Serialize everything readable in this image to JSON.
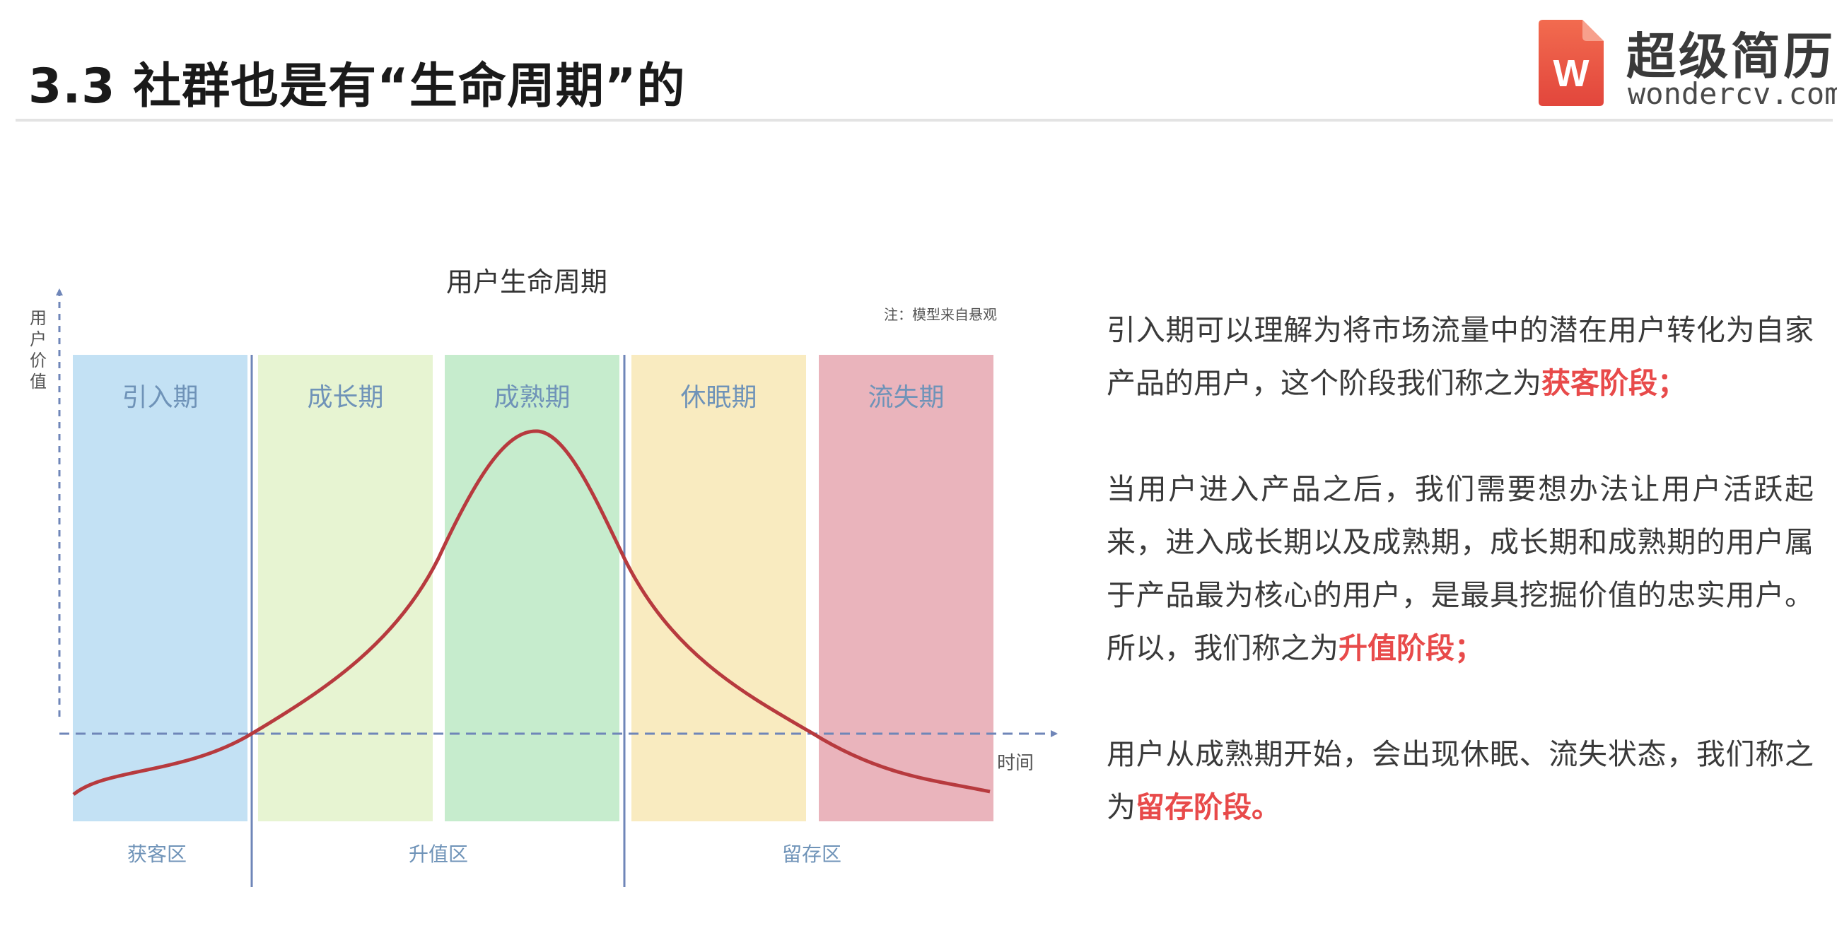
{
  "header": {
    "title": "3.3 社群也是有“生命周期”的"
  },
  "logo": {
    "mark": "W",
    "cn": "超级简历",
    "en": "wondercv.com"
  },
  "diagram": {
    "title": "用户生命周期",
    "note": "注：模型来自悬观",
    "y_axis_label": [
      "用",
      "户",
      "价",
      "值"
    ],
    "x_axis_label": "时间",
    "stages": [
      {
        "label": "引入期",
        "color": "#c3e1f4"
      },
      {
        "label": "成长期",
        "color": "#e7f4d2"
      },
      {
        "label": "成熟期",
        "color": "#c6eccd"
      },
      {
        "label": "休眠期",
        "color": "#f9ebc0"
      },
      {
        "label": "流失期",
        "color": "#eab4bc"
      }
    ],
    "stage_label_color": "#6f93b8",
    "zones": [
      "获客区",
      "升值区",
      "留存区"
    ],
    "curve_color": "#b73a3e",
    "baseline_color": "#6f86b8"
  },
  "description": {
    "highlight_color": "#e84a4a",
    "paragraphs": [
      {
        "text": "引入期可以理解为将市场流量中的潜在用户转化为自家产品的用户，这个阶段我们称之为",
        "highlight": "获客阶段；"
      },
      {
        "text": "当用户进入产品之后，我们需要想办法让用户活跃起来，进入成长期以及成熟期，成长期和成熟期的用户属于产品最为核心的用户，是最具挖掘价值的忠实用户。所以，我们称之为",
        "highlight": "升值阶段；"
      },
      {
        "text": "用户从成熟期开始，会出现休眠、流失状态，我们称之为",
        "highlight": "留存阶段。"
      }
    ]
  }
}
